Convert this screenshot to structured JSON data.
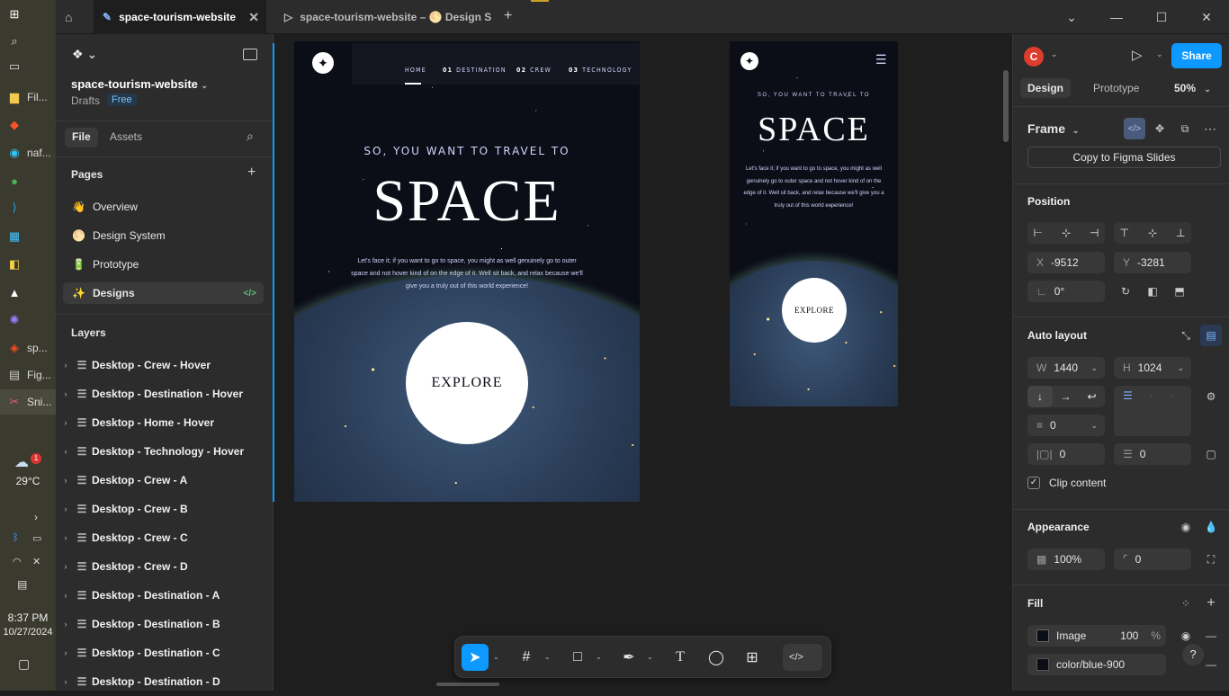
{
  "taskbar": {
    "items": [
      {
        "icon": "windows-start-icon",
        "label": ""
      },
      {
        "icon": "search-icon",
        "label": ""
      },
      {
        "icon": "task-view-icon",
        "label": ""
      },
      {
        "icon": "file-explorer-icon",
        "label": "Fil..."
      },
      {
        "icon": "brave-icon",
        "label": ""
      },
      {
        "icon": "edge-icon",
        "label": "naf..."
      },
      {
        "icon": "chrome-icon",
        "label": ""
      },
      {
        "icon": "vscode-icon",
        "label": ""
      },
      {
        "icon": "store-icon",
        "label": ""
      },
      {
        "icon": "python-icon",
        "label": ""
      },
      {
        "icon": "app-icon",
        "label": ""
      },
      {
        "icon": "copilot-icon",
        "label": ""
      },
      {
        "icon": "figma-app-icon",
        "label": "sp..."
      },
      {
        "icon": "figma-window-icon",
        "label": "Fig..."
      },
      {
        "icon": "snipping-tool-icon",
        "label": "Sni..."
      }
    ],
    "weather": {
      "temp": "29°C",
      "badge": "1"
    },
    "clock": {
      "time": "8:37 PM",
      "date": "10/27/2024"
    }
  },
  "titlebar": {
    "tabs": [
      {
        "label": "space-tourism-website",
        "active": true
      },
      {
        "label": "space-tourism-website – 🌕 Design S",
        "active": false
      }
    ]
  },
  "left": {
    "file_name": "space-tourism-website",
    "drafts": "Drafts",
    "plan_badge": "Free",
    "tab_file": "File",
    "tab_assets": "Assets",
    "pages_title": "Pages",
    "pages": [
      {
        "emoji": "👋",
        "label": "Overview",
        "selected": false
      },
      {
        "emoji": "🌕",
        "label": "Design System",
        "selected": false
      },
      {
        "emoji": "🔋",
        "label": "Prototype",
        "selected": false
      },
      {
        "emoji": "✨",
        "label": "Designs",
        "selected": true
      }
    ],
    "layers_title": "Layers",
    "layers": [
      "Desktop - Crew - Hover",
      "Desktop - Destination - Hover",
      "Desktop - Home - Hover",
      "Desktop - Technology - Hover",
      "Desktop - Crew - A",
      "Desktop - Crew - B",
      "Desktop - Crew - C",
      "Desktop - Crew - D",
      "Desktop - Destination - A",
      "Desktop - Destination - B",
      "Desktop - Destination - C",
      "Desktop - Destination - D"
    ]
  },
  "canvas": {
    "desktop": {
      "nav": [
        {
          "num": "",
          "label": "HOME"
        },
        {
          "num": "01",
          "label": "DESTINATION"
        },
        {
          "num": "02",
          "label": "CREW"
        },
        {
          "num": "03",
          "label": "TECHNOLOGY"
        }
      ],
      "subtitle": "SO, YOU WANT TO TRAVEL TO",
      "title": "SPACE",
      "body": "Let's face it; if you want to go to space, you might as well genuinely go to outer space and not hover kind of on the edge of it. Well sit back, and relax because we'll give you a truly out of this world experience!",
      "cta": "EXPLORE"
    },
    "mobile": {
      "subtitle": "SO, YOU WANT TO TRAVEL TO",
      "title": "SPACE",
      "body": "Let's face it; if you want to go to space, you might as well genuinely go to outer space and not hover kind of on the edge of it. Well sit back, and relax because we'll give you a truly out of this world experience!",
      "cta": "EXPLORE"
    }
  },
  "right": {
    "avatar_letter": "C",
    "share": "Share",
    "tab_design": "Design",
    "tab_prototype": "Prototype",
    "zoom": "50%",
    "frame_label": "Frame",
    "copy_slides": "Copy to Figma Slides",
    "position_title": "Position",
    "x_label": "X",
    "x_value": "-9512",
    "y_label": "Y",
    "y_value": "-3281",
    "rotation": "0°",
    "autolayout_title": "Auto layout",
    "w_label": "W",
    "w_value": "1440",
    "h_label": "H",
    "h_value": "1024",
    "gap_value": "0",
    "pad_h": "0",
    "pad_v": "0",
    "clip_content": "Clip content",
    "appearance_title": "Appearance",
    "opacity": "100%",
    "radius": "0",
    "fill_title": "Fill",
    "fill_image_label": "Image",
    "fill_image_opacity": "100",
    "fill_pct": "%",
    "fill_color_label": "color/blue-900"
  },
  "colors": {
    "accent": "#0d99ff",
    "avatar": "#e03c2c",
    "bg_space": "#0b0d17"
  }
}
